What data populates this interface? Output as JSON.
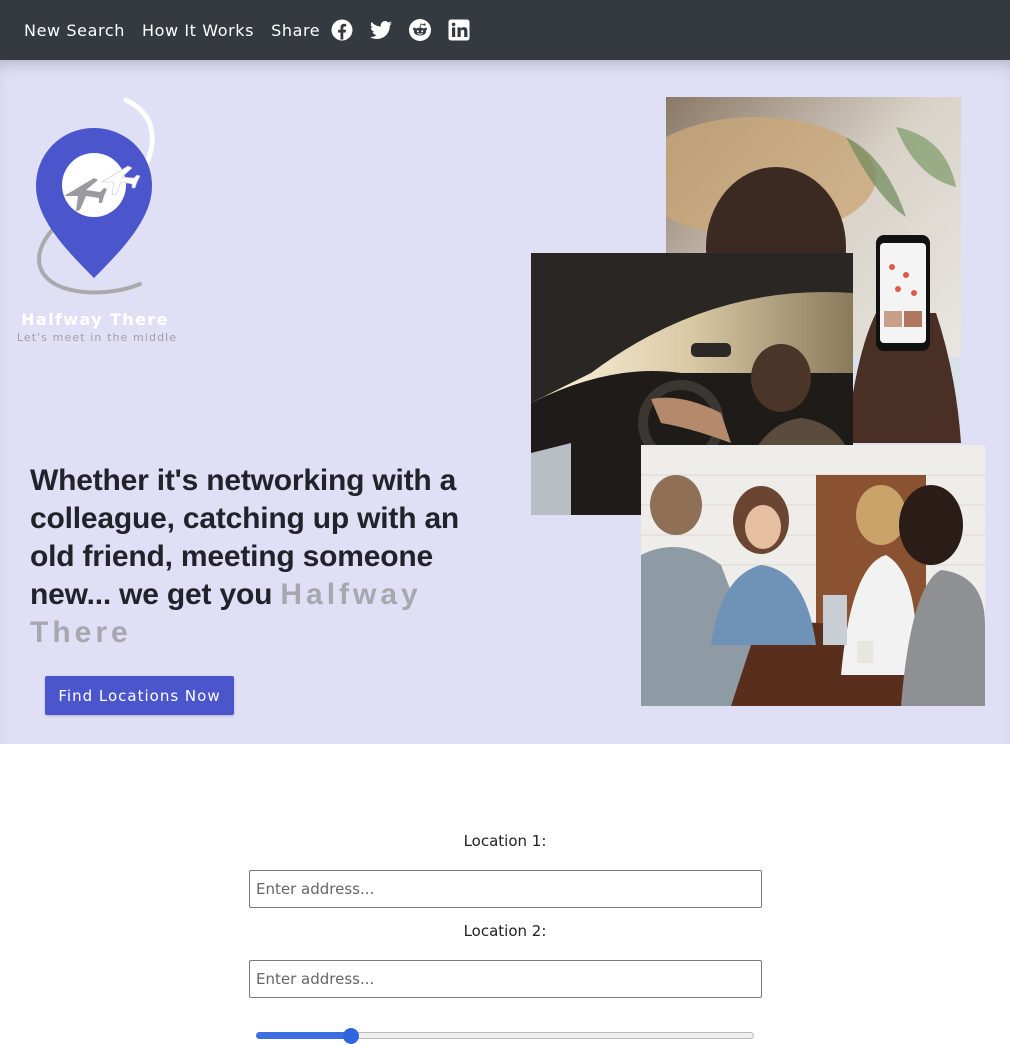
{
  "nav": {
    "links": [
      {
        "label": "New Search"
      },
      {
        "label": "How It Works"
      }
    ],
    "share_label": "Share",
    "social_icons": [
      "facebook-icon",
      "twitter-icon",
      "reddit-icon",
      "linkedin-icon"
    ]
  },
  "brand": {
    "name": "Halfway There",
    "tagline": "Let's meet in the middle",
    "pin_color": "#4b56cc"
  },
  "hero": {
    "headline": "Whether it's networking with a colleague, catching up with an old friend, meeting someone new... we get you ",
    "headline_accent": "Halfway There",
    "cta_label": "Find Locations Now",
    "background": "#dfdff6"
  },
  "form": {
    "location1_label": "Location 1:",
    "location1_placeholder": "Enter address...",
    "location1_value": "",
    "location2_label": "Location 2:",
    "location2_placeholder": "Enter address...",
    "location2_value": "",
    "slider_fraction": 0.19
  },
  "colors": {
    "nav_bg": "#343a40",
    "accent": "#4b56cc",
    "slider": "#3c6fe0"
  }
}
